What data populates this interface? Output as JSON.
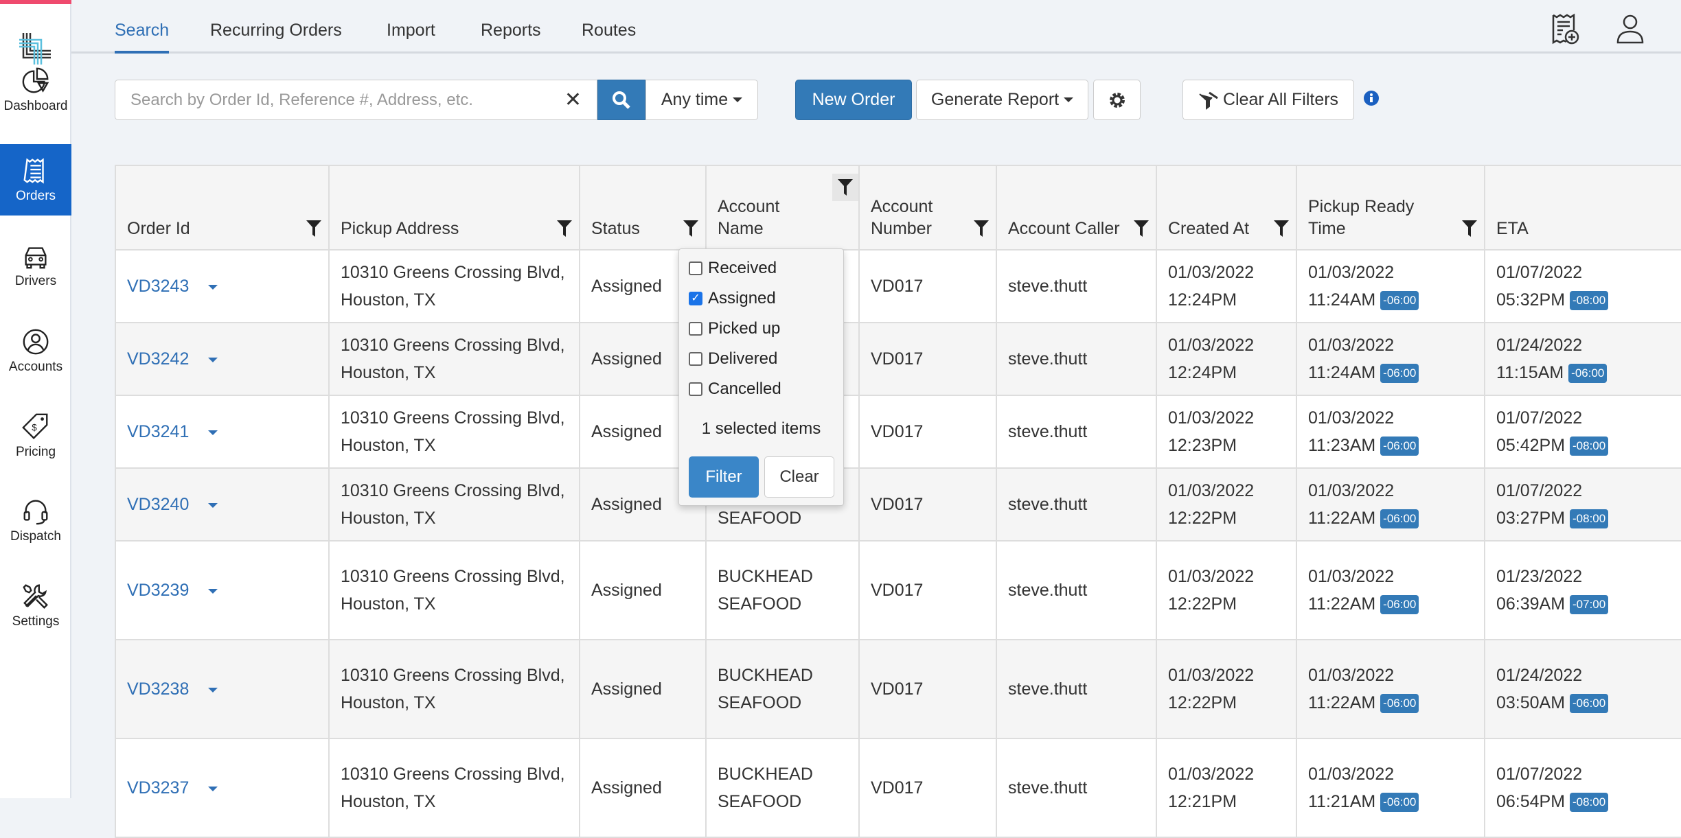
{
  "sidebar": {
    "items": [
      {
        "label": "Dashboard",
        "icon": "pie-chart-icon"
      },
      {
        "label": "Orders",
        "icon": "receipt-icon",
        "active": true
      },
      {
        "label": "Drivers",
        "icon": "car-icon"
      },
      {
        "label": "Accounts",
        "icon": "user-circle-icon"
      },
      {
        "label": "Pricing",
        "icon": "price-tag-icon"
      },
      {
        "label": "Dispatch",
        "icon": "headset-icon"
      },
      {
        "label": "Settings",
        "icon": "tools-icon"
      }
    ]
  },
  "tabs": [
    "Search",
    "Recurring Orders",
    "Import",
    "Reports",
    "Routes"
  ],
  "toolbar": {
    "search_placeholder": "Search by Order Id, Reference #, Address, etc.",
    "time_label": "Any time",
    "new_order": "New Order",
    "generate_report": "Generate Report",
    "clear_filters": "Clear All Filters"
  },
  "colors": {
    "accent": "#337ab7",
    "active_nav": "#1565c8",
    "top_stripe": "#ef4a6e"
  },
  "table": {
    "headers": [
      "Order Id",
      "Pickup Address",
      "Status",
      "Account Name",
      "Account Number",
      "Account Caller",
      "Created At",
      "Pickup Ready Time",
      "ETA"
    ],
    "rows": [
      {
        "id": "VD3243",
        "addr1": "10310 Greens Crossing Blvd,",
        "addr2": "Houston, TX",
        "status": "Assigned",
        "acct1": "",
        "acct2": "",
        "num": "VD017",
        "caller": "steve.thutt",
        "cd": "01/03/2022",
        "ct": "12:24PM",
        "pd": "01/03/2022",
        "pt": "11:24AM",
        "ptz": "-06:00",
        "ed": "01/07/2022",
        "et": "05:32PM",
        "etz": "-08:00"
      },
      {
        "id": "VD3242",
        "addr1": "10310 Greens Crossing Blvd,",
        "addr2": "Houston, TX",
        "status": "Assigned",
        "acct1": "",
        "acct2": "",
        "num": "VD017",
        "caller": "steve.thutt",
        "cd": "01/03/2022",
        "ct": "12:24PM",
        "pd": "01/03/2022",
        "pt": "11:24AM",
        "ptz": "-06:00",
        "ed": "01/24/2022",
        "et": "11:15AM",
        "etz": "-06:00"
      },
      {
        "id": "VD3241",
        "addr1": "10310 Greens Crossing Blvd,",
        "addr2": "Houston, TX",
        "status": "Assigned",
        "acct1": "",
        "acct2": "",
        "num": "VD017",
        "caller": "steve.thutt",
        "cd": "01/03/2022",
        "ct": "12:23PM",
        "pd": "01/03/2022",
        "pt": "11:23AM",
        "ptz": "-06:00",
        "ed": "01/07/2022",
        "et": "05:42PM",
        "etz": "-08:00"
      },
      {
        "id": "VD3240",
        "addr1": "10310 Greens Crossing Blvd,",
        "addr2": "Houston, TX",
        "status": "Assigned",
        "acct1": "",
        "acct2": "SEAFOOD",
        "num": "VD017",
        "caller": "steve.thutt",
        "cd": "01/03/2022",
        "ct": "12:22PM",
        "pd": "01/03/2022",
        "pt": "11:22AM",
        "ptz": "-06:00",
        "ed": "01/07/2022",
        "et": "03:27PM",
        "etz": "-08:00"
      },
      {
        "id": "VD3239",
        "addr1": "10310 Greens Crossing Blvd,",
        "addr2": "Houston, TX",
        "status": "Assigned",
        "acct1": "BUCKHEAD",
        "acct2": "SEAFOOD",
        "num": "VD017",
        "caller": "steve.thutt",
        "cd": "01/03/2022",
        "ct": "12:22PM",
        "pd": "01/03/2022",
        "pt": "11:22AM",
        "ptz": "-06:00",
        "ed": "01/23/2022",
        "et": "06:39AM",
        "etz": "-07:00"
      },
      {
        "id": "VD3238",
        "addr1": "10310 Greens Crossing Blvd,",
        "addr2": "Houston, TX",
        "status": "Assigned",
        "acct1": "BUCKHEAD",
        "acct2": "SEAFOOD",
        "num": "VD017",
        "caller": "steve.thutt",
        "cd": "01/03/2022",
        "ct": "12:22PM",
        "pd": "01/03/2022",
        "pt": "11:22AM",
        "ptz": "-06:00",
        "ed": "01/24/2022",
        "et": "03:50AM",
        "etz": "-06:00"
      },
      {
        "id": "VD3237",
        "addr1": "10310 Greens Crossing Blvd,",
        "addr2": "Houston, TX",
        "status": "Assigned",
        "acct1": "BUCKHEAD",
        "acct2": "SEAFOOD",
        "num": "VD017",
        "caller": "steve.thutt",
        "cd": "01/03/2022",
        "ct": "12:21PM",
        "pd": "01/03/2022",
        "pt": "11:21AM",
        "ptz": "-06:00",
        "ed": "01/07/2022",
        "et": "06:54PM",
        "etz": "-08:00"
      }
    ]
  },
  "status_filter": {
    "options": [
      {
        "label": "Received",
        "checked": false
      },
      {
        "label": "Assigned",
        "checked": true
      },
      {
        "label": "Picked up",
        "checked": false
      },
      {
        "label": "Delivered",
        "checked": false
      },
      {
        "label": "Cancelled",
        "checked": false
      }
    ],
    "summary": "1 selected items",
    "filter_label": "Filter",
    "clear_label": "Clear"
  }
}
